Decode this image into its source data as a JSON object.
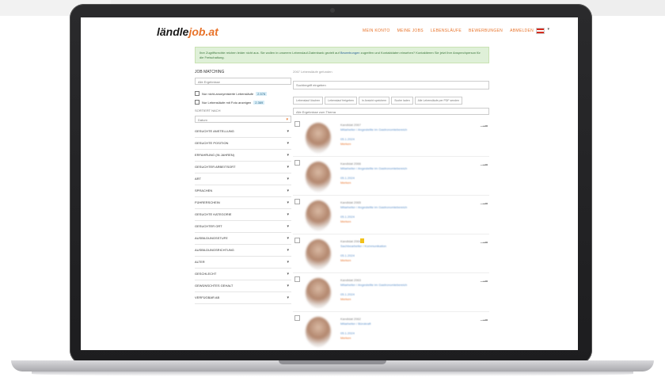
{
  "site": {
    "logo_prefix": "ländle",
    "logo_accent": "job.at",
    "accent_color": "#e8732a"
  },
  "nav": [
    "Mein Konto",
    "Meine Jobs",
    "Lebensläufe",
    "Bewerbungen",
    "Abmelden"
  ],
  "notice": {
    "text": "Ihre Zugriffsrechte reichen leider nicht aus. Sie wollen in unserem Lebenslauf-Datenbank gezielt auf",
    "link": "Bewerbungen",
    "text2": "zugreifen und Kontaktdaten einsehen? Kontaktieren Sie jetzt Ihre Ansprechperson für die Freischaltung."
  },
  "sidebar": {
    "title": "Job Matching",
    "select_placeholder": "Alle Ergebnisse",
    "check1": "Nur nicht-anonymisierte Lebensläufe",
    "check1_badge": "2.576",
    "check2": "Nur Lebensläufe mit Foto anzeigen",
    "check2_badge": "2.369",
    "sort_label": "Sortiert nach",
    "sort_value": "Datum",
    "filters": [
      "Gesuchte Anstellung",
      "Gesuchte Position",
      "Erfahrung (in Jahren)",
      "Gesuchter Arbeitsort",
      "Art",
      "Sprachen",
      "Führerschein",
      "Gesuchte Kategorie",
      "Gesuchter Ort",
      "Ausbildungsstufe",
      "Ausbildungsrichtung",
      "Alter",
      "Geschlecht",
      "Gewünschtes Gehalt",
      "Verfügbar ab"
    ]
  },
  "main": {
    "hint": "2067 Lebensläufe gefunden",
    "search_placeholder": "Suchbegriff eingeben",
    "chips": [
      "Lebenslauf löschen",
      "Lebenslauf freigeben",
      "In Ansicht speichern",
      "Suche laden",
      "Alle Lebensläufe per PDF senden"
    ],
    "sort_text": "Alle Ergebnisse zum Thema",
    "results": [
      {
        "name": "Kandidat 2067",
        "job": "Mitarbeiter / Angestellte im Gastronomiebereich",
        "date": "05.1.2024",
        "link": "Merken",
        "badge": false
      },
      {
        "name": "Kandidat 2066",
        "job": "Mitarbeiter / Angestellte im Gastronomiebereich",
        "date": "05.1.2024",
        "link": "Merken",
        "badge": false
      },
      {
        "name": "Kandidat 2065",
        "job": "Mitarbeiter / Angestellte im Gastronomiebereich",
        "date": "05.1.2024",
        "link": "Merken",
        "badge": false
      },
      {
        "name": "Kandidat 2064",
        "job": "Sachbearbeiter / Kommunikation",
        "date": "05.1.2024",
        "link": "Merken",
        "badge": true
      },
      {
        "name": "Kandidat 2063",
        "job": "Mitarbeiter / Angestellte im Gastronomiebereich",
        "date": "05.1.2024",
        "link": "Merken",
        "badge": false
      },
      {
        "name": "Kandidat 2062",
        "job": "Mitarbeiter / Bürokraft",
        "date": "05.1.2024",
        "link": "Merken",
        "badge": false
      }
    ]
  }
}
